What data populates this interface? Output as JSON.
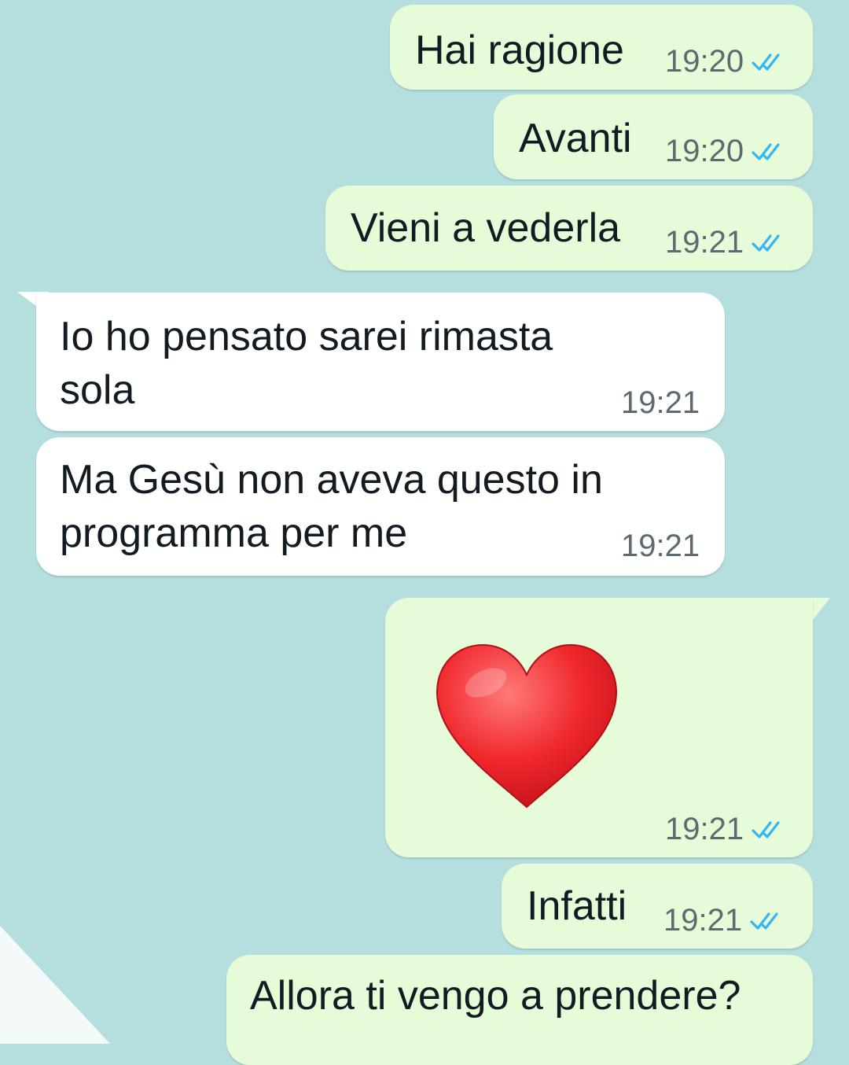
{
  "colors": {
    "background": "#b5dfdf",
    "outgoing_bubble": "#e6fbd8",
    "incoming_bubble": "#ffffff",
    "read_tick": "#34b7f1",
    "timestamp": "#5d6a70"
  },
  "messages": [
    {
      "direction": "outgoing",
      "text": "Hai ragione",
      "time": "19:20",
      "status": "read-ticks-icon"
    },
    {
      "direction": "outgoing",
      "text": "Avanti",
      "time": "19:20",
      "status": "read-ticks-icon"
    },
    {
      "direction": "outgoing",
      "text": "Vieni a vederla",
      "time": "19:21",
      "status": "read-ticks-icon"
    },
    {
      "direction": "incoming",
      "lines": [
        "Io ho pensato sarei rimasta",
        "sola"
      ],
      "time": "19:21"
    },
    {
      "direction": "incoming",
      "lines": [
        "Ma Gesù non aveva questo in",
        "programma per me"
      ],
      "time": "19:21"
    },
    {
      "direction": "outgoing",
      "emoji": "red-heart-icon",
      "time": "19:21",
      "status": "read-ticks-icon"
    },
    {
      "direction": "outgoing",
      "text": "Infatti",
      "time": "19:21",
      "status": "read-ticks-icon"
    },
    {
      "direction": "outgoing",
      "text": "Allora ti vengo a prendere?"
    }
  ]
}
